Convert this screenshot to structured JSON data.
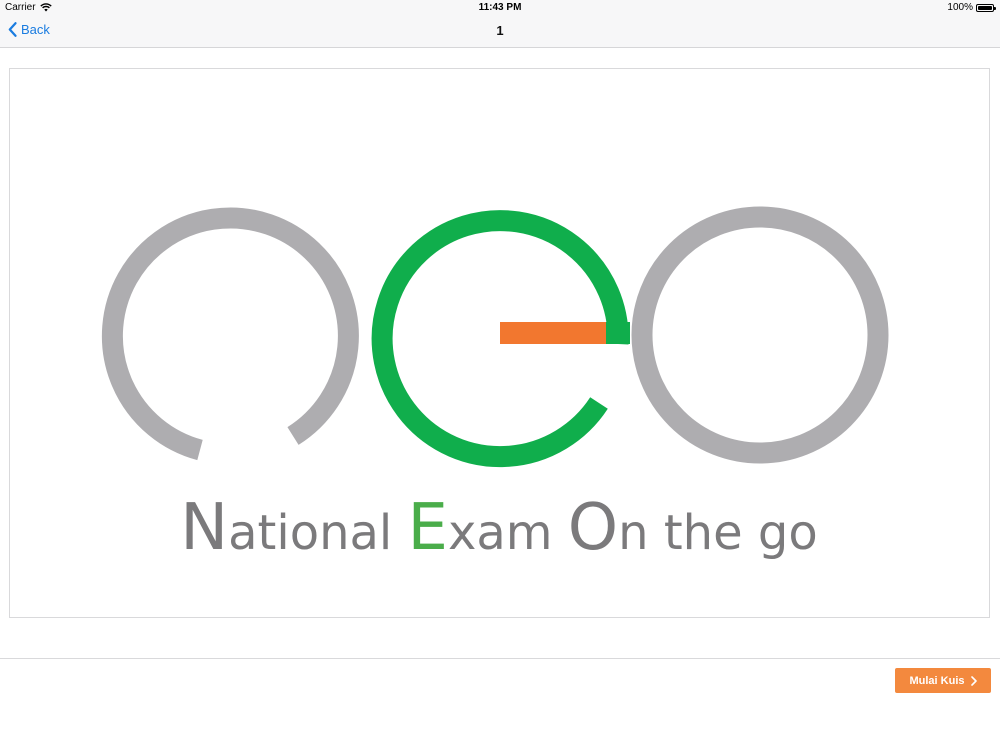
{
  "status_bar": {
    "carrier": "Carrier",
    "time": "11:43 PM",
    "battery": "100%"
  },
  "nav_bar": {
    "back_label": "Back",
    "title": "1"
  },
  "logo": {
    "letters": [
      "N",
      "ational ",
      "E",
      "xam ",
      "O",
      "n the go"
    ],
    "colors": {
      "gray_ring": "#aeadb0",
      "green_ring": "#10ae4c",
      "orange_bar": "#f2772f",
      "text_gray": "#7b7a7c",
      "text_green": "#4aad4a"
    }
  },
  "footer": {
    "start_button_label": "Mulai Kuis",
    "start_button_color": "#f3893e"
  },
  "icons": {
    "wifi": "wifi-icon",
    "battery": "battery-icon",
    "back": "chevron-left-icon",
    "next": "chevron-right-icon"
  }
}
